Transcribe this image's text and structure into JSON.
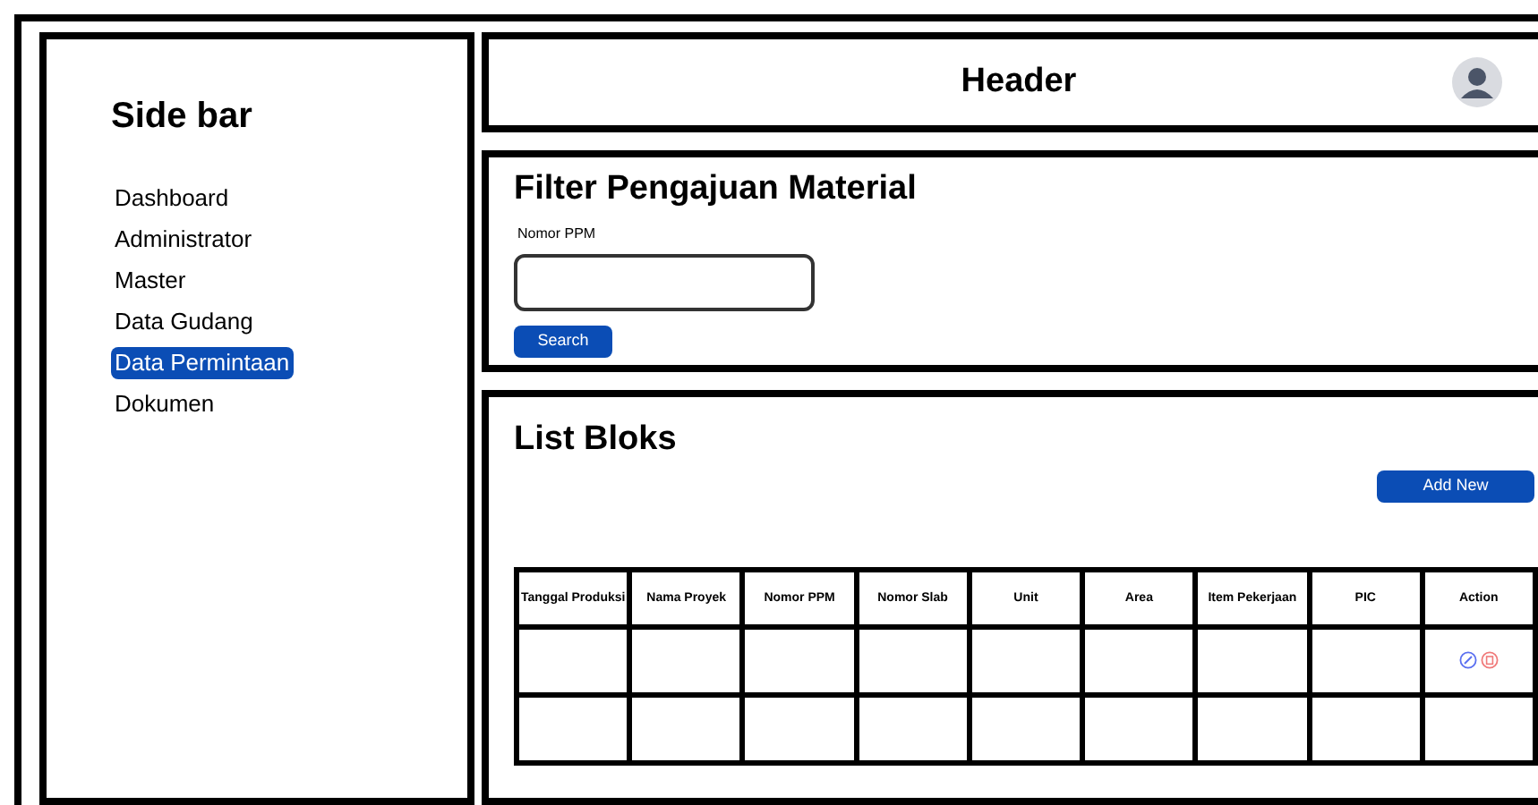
{
  "sidebar": {
    "title": "Side bar",
    "items": [
      {
        "label": "Dashboard",
        "selected": false
      },
      {
        "label": "Administrator",
        "selected": false
      },
      {
        "label": "Master",
        "selected": false
      },
      {
        "label": "Data Gudang",
        "selected": false
      },
      {
        "label": "Data Permintaan",
        "selected": true
      },
      {
        "label": "Dokumen",
        "selected": false
      }
    ]
  },
  "header": {
    "title": "Header"
  },
  "filter": {
    "title": "Filter Pengajuan Material",
    "field_label": "Nomor PPM",
    "button": "Search"
  },
  "list": {
    "title": "List Bloks",
    "add_button": "Add New",
    "columns": [
      "Tanggal Produksi",
      "Nama Proyek",
      "Nomor PPM",
      "Nomor Slab",
      "Unit",
      "Area",
      "Item Pekerjaan",
      "PIC",
      "Action"
    ],
    "rows": [
      {
        "has_actions": true
      },
      {
        "has_actions": false
      }
    ]
  }
}
